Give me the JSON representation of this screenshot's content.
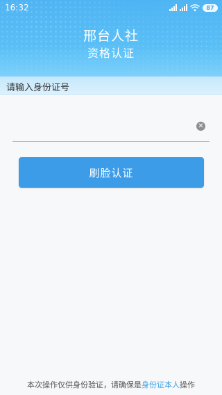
{
  "status_bar": {
    "time": "16:32",
    "battery": "87",
    "icons": [
      "signal-icon",
      "signal-icon",
      "wifi-icon",
      "battery-icon"
    ]
  },
  "header": {
    "title": "邢台人社",
    "subtitle": "资格认证"
  },
  "form": {
    "section_label": "请输入身份证号",
    "id_value": "",
    "clear_icon": "clear-icon"
  },
  "actions": {
    "face_auth_label": "刷脸认证"
  },
  "footer": {
    "text_before": "本次操作仅供身份验证，请确保是",
    "highlight": "身份证本人",
    "text_after": "操作"
  },
  "colors": {
    "header_blue": "#59bff6",
    "button_blue": "#3d9ce8",
    "highlight_blue": "#3aa0e6"
  }
}
